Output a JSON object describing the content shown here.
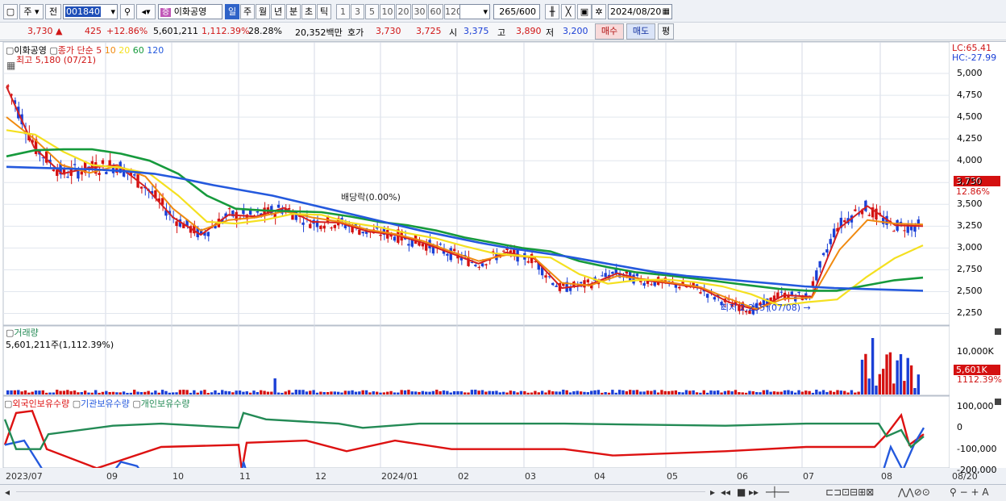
{
  "toolbar": {
    "period_type": "주",
    "prev_label": "전",
    "stock_code": "001840",
    "stock_badge": "증",
    "stock_name": "이화공영",
    "tabs": [
      "일",
      "주",
      "월",
      "년",
      "분",
      "초",
      "틱"
    ],
    "tabs_selected": "일",
    "intervals": [
      "1",
      "3",
      "5",
      "10",
      "20",
      "30",
      "60",
      "120"
    ],
    "count": "265",
    "count_total": "/600",
    "date": "2024/08/20"
  },
  "info": {
    "price": "3,730",
    "change": "425",
    "change_pct": "+12.86%",
    "volume": "5,601,211",
    "volume_pct": "1,112.39%",
    "turnover": "28.28%",
    "amount": "20,352백만",
    "quote_label": "호가",
    "ask": "3,730",
    "bid": "3,725",
    "open_label": "시",
    "open": "3,375",
    "high_label": "고",
    "high": "3,890",
    "low_label": "저",
    "low": "3,200",
    "buy_label": "매수",
    "sell_label": "매도",
    "eval_label": "평"
  },
  "price_panel": {
    "stock_label": "이화공영",
    "ma_label": "종가 단순",
    "ma_periods": [
      "5",
      "10",
      "20",
      "60",
      "120"
    ],
    "high_marker": "최고 5,180 (07/21)",
    "low_marker": "최저 2,255 (07/08)",
    "dividend_label": "배당락(0.00%)",
    "lc": "LC:65.41",
    "hc": "HC:-27.99",
    "current_tag": "3,730",
    "current_pct": "12.86%",
    "y_ticks": [
      "5,000",
      "4,750",
      "4,500",
      "4,250",
      "4,000",
      "3,750",
      "3,500",
      "3,250",
      "3,000",
      "2,750",
      "2,500",
      "2,250"
    ]
  },
  "volume_panel": {
    "title": "거래량",
    "value": "5,601,211주(1,112.39%)",
    "y_tick": "10,000K",
    "current_tag": "5,601K",
    "current_pct": "1112.39%"
  },
  "holding_panel": {
    "legend": [
      "외국인보유수량",
      "기관보유수량",
      "개인보유수량"
    ],
    "y_ticks": [
      "100,000",
      "0",
      "-100,000",
      "-200,000"
    ]
  },
  "x_axis": [
    "2023/07",
    "09",
    "10",
    "11",
    "12",
    "2024/01",
    "02",
    "03",
    "04",
    "05",
    "06",
    "07",
    "08",
    "08/20"
  ],
  "colors": {
    "ma5": "#d42020",
    "ma10": "#f08a10",
    "ma20": "#f4e020",
    "ma60": "#169a3c",
    "ma120": "#2459dd",
    "foreign": "#dd1111",
    "institution": "#2459dd",
    "individual": "#238a55"
  },
  "chart_data": {
    "type": "line",
    "title": "이화공영",
    "x": [
      "2023/07",
      "09",
      "10",
      "11",
      "12",
      "2024/01",
      "02",
      "03",
      "04",
      "05",
      "06",
      "07",
      "08",
      "08/20"
    ],
    "ylim": [
      2125,
      5250
    ],
    "series": [
      {
        "name": "5",
        "values": [
          4850,
          4150,
          3850,
          3920,
          3950,
          3700,
          3350,
          3150,
          3380,
          3360,
          3460,
          3300,
          3290,
          3190,
          3150,
          3060,
          2940,
          2820,
          2950,
          2880,
          2540,
          2580,
          2710,
          2630,
          2590,
          2540,
          2380,
          2290,
          2460,
          2440,
          3230,
          3480,
          3260,
          3250
        ]
      },
      {
        "name": "10",
        "values": [
          4500,
          4250,
          3950,
          3860,
          3940,
          3820,
          3450,
          3200,
          3320,
          3350,
          3420,
          3350,
          3300,
          3210,
          3160,
          3080,
          2960,
          2850,
          2920,
          2890,
          2600,
          2570,
          2680,
          2640,
          2600,
          2550,
          2420,
          2300,
          2420,
          2430,
          2980,
          3320,
          3280,
          3270
        ]
      },
      {
        "name": "20",
        "values": [
          4350,
          4300,
          4100,
          3950,
          3920,
          3850,
          3600,
          3300,
          3280,
          3320,
          3390,
          3380,
          3290,
          3240,
          3170,
          3110,
          3020,
          2940,
          2910,
          2890,
          2700,
          2590,
          2630,
          2640,
          2610,
          2560,
          2470,
          2340,
          2380,
          2410,
          2660,
          2880,
          3030
        ]
      },
      {
        "name": "60",
        "values": [
          4050,
          4120,
          4130,
          4130,
          4080,
          4000,
          3850,
          3600,
          3450,
          3430,
          3420,
          3410,
          3360,
          3300,
          3260,
          3200,
          3120,
          3060,
          3000,
          2960,
          2850,
          2780,
          2720,
          2690,
          2650,
          2610,
          2570,
          2530,
          2510,
          2510,
          2570,
          2630,
          2660
        ]
      },
      {
        "name": "120",
        "values": [
          3930,
          3920,
          3910,
          3900,
          3880,
          3850,
          3790,
          3720,
          3660,
          3600,
          3520,
          3440,
          3360,
          3280,
          3200,
          3130,
          3060,
          3000,
          2950,
          2900,
          2840,
          2780,
          2720,
          2680,
          2650,
          2620,
          2590,
          2560,
          2540,
          2530,
          2520,
          2510
        ]
      }
    ]
  }
}
